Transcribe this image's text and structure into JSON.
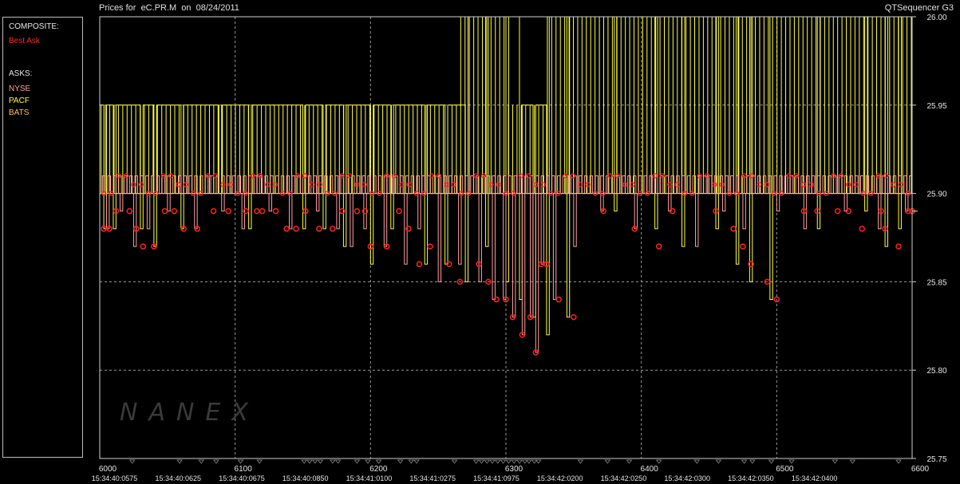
{
  "header": {
    "title": "Prices for  eC.PR.M  on  08/24/2011",
    "app": "QTSequencer G3"
  },
  "legend": {
    "composite_heading": "COMPOSITE:",
    "composite_item": "Best Ask",
    "asks_heading": "ASKS:",
    "asks_items": [
      "NYSE",
      "PACF",
      "BATS"
    ]
  },
  "colors": {
    "background": "#000000",
    "plot_border": "#cfcfcf",
    "grid": "#9a9a9a",
    "best_ask": "#ff2020",
    "nyse": "#ffa0a0",
    "pacf": "#ffff40",
    "bats": "#ffc060",
    "tick_marker": "#8a8a8a"
  },
  "watermark": "NANEX",
  "chart_data": {
    "type": "line",
    "title": "Prices for  eC.PR.M  on  08/24/2011",
    "ylim": [
      25.75,
      26.0
    ],
    "y_ticks": [
      "25.75",
      "25.80",
      "25.85",
      "25.90",
      "25.95",
      "26.00"
    ],
    "y_tick_values": [
      25.75,
      25.8,
      25.85,
      25.9,
      25.95,
      26.0
    ],
    "xlim": [
      6000,
      6600
    ],
    "x_ticks": [
      "6000",
      "6100",
      "6200",
      "6300",
      "6400",
      "6500",
      "6600"
    ],
    "x_tick_values": [
      6000,
      6100,
      6200,
      6300,
      6400,
      6500,
      6600
    ],
    "time_labels": [
      {
        "seq": 6005,
        "label": "15:34:40:0575"
      },
      {
        "seq": 6052,
        "label": "15:34:40:0625"
      },
      {
        "seq": 6099,
        "label": "15:34:40:0675"
      },
      {
        "seq": 6146,
        "label": "15:34:40:0850"
      },
      {
        "seq": 6193,
        "label": "15:34:41:0100"
      },
      {
        "seq": 6240,
        "label": "15:34:41:0275"
      },
      {
        "seq": 6287,
        "label": "15:34:41:0975"
      },
      {
        "seq": 6334,
        "label": "15:34:42:0200"
      },
      {
        "seq": 6381,
        "label": "15:34:42:0250"
      },
      {
        "seq": 6428,
        "label": "15:34:42:0300"
      },
      {
        "seq": 6475,
        "label": "15:34:42:0350"
      },
      {
        "seq": 6522,
        "label": "15:34:42:0400"
      }
    ],
    "time_markers": [
      6024,
      6059,
      6075,
      6086,
      6104,
      6118,
      6151,
      6155,
      6159,
      6163,
      6172,
      6176,
      6190,
      6198,
      6206,
      6222,
      6230,
      6234,
      6262,
      6278,
      6282,
      6286,
      6290,
      6294,
      6298,
      6302,
      6306,
      6310,
      6314,
      6317,
      6321,
      6324,
      6355,
      6375,
      6391,
      6413,
      6441,
      6457,
      6476,
      6482,
      6496,
      6511,
      6543,
      6556,
      6590
    ],
    "series": [
      {
        "name": "PACF",
        "role": "step",
        "baseline": 25.95,
        "high_baseline": 26.0,
        "high_segments": [
          [
            6265,
            6300
          ],
          [
            6330,
            6600
          ]
        ],
        "dips": [
          [
            6003,
            25.88
          ],
          [
            6010,
            25.88
          ],
          [
            6030,
            25.88
          ],
          [
            6040,
            25.87
          ],
          [
            6060,
            25.88
          ],
          [
            6088,
            25.9
          ],
          [
            6110,
            25.88
          ],
          [
            6150,
            25.88
          ],
          [
            6165,
            25.88
          ],
          [
            6180,
            25.87
          ],
          [
            6200,
            25.86
          ],
          [
            6215,
            25.88
          ],
          [
            6240,
            25.86
          ],
          [
            6255,
            25.86
          ],
          [
            6270,
            25.85
          ],
          [
            6285,
            25.87
          ],
          [
            6300,
            25.85
          ],
          [
            6310,
            25.84
          ],
          [
            6320,
            25.83
          ],
          [
            6330,
            25.82
          ],
          [
            6345,
            25.83
          ],
          [
            6380,
            25.89
          ],
          [
            6410,
            25.88
          ],
          [
            6430,
            25.87
          ],
          [
            6455,
            25.88
          ],
          [
            6470,
            25.86
          ],
          [
            6480,
            25.85
          ],
          [
            6495,
            25.84
          ],
          [
            6530,
            25.88
          ],
          [
            6565,
            25.89
          ],
          [
            6580,
            25.87
          ],
          [
            6590,
            25.88
          ]
        ]
      },
      {
        "name": "NYSE",
        "role": "step",
        "baseline": 25.9,
        "high": 25.91,
        "dips": [
          [
            6005,
            25.88
          ],
          [
            6015,
            25.89
          ],
          [
            6025,
            25.87
          ],
          [
            6035,
            25.88
          ],
          [
            6050,
            25.89
          ],
          [
            6070,
            25.88
          ],
          [
            6090,
            25.89
          ],
          [
            6105,
            25.88
          ],
          [
            6125,
            25.89
          ],
          [
            6140,
            25.88
          ],
          [
            6160,
            25.89
          ],
          [
            6175,
            25.88
          ],
          [
            6185,
            25.87
          ],
          [
            6195,
            25.88
          ],
          [
            6210,
            25.87
          ],
          [
            6225,
            25.86
          ],
          [
            6235,
            25.88
          ],
          [
            6250,
            25.85
          ],
          [
            6265,
            25.86
          ],
          [
            6280,
            25.85
          ],
          [
            6290,
            25.84
          ],
          [
            6298,
            25.84
          ],
          [
            6305,
            25.83
          ],
          [
            6312,
            25.82
          ],
          [
            6318,
            25.83
          ],
          [
            6322,
            25.81
          ],
          [
            6326,
            25.86
          ],
          [
            6335,
            25.84
          ],
          [
            6350,
            25.87
          ],
          [
            6370,
            25.89
          ],
          [
            6395,
            25.88
          ],
          [
            6420,
            25.89
          ],
          [
            6440,
            25.87
          ],
          [
            6460,
            25.89
          ],
          [
            6475,
            25.88
          ],
          [
            6500,
            25.89
          ],
          [
            6520,
            25.88
          ],
          [
            6550,
            25.89
          ],
          [
            6575,
            25.88
          ],
          [
            6595,
            25.89
          ]
        ]
      },
      {
        "name": "Best Ask",
        "role": "points",
        "points": [
          [
            6003,
            25.88
          ],
          [
            6007,
            25.88
          ],
          [
            6012,
            25.89
          ],
          [
            6022,
            25.89
          ],
          [
            6027,
            25.88
          ],
          [
            6032,
            25.87
          ],
          [
            6040,
            25.87
          ],
          [
            6048,
            25.89
          ],
          [
            6055,
            25.89
          ],
          [
            6062,
            25.88
          ],
          [
            6072,
            25.88
          ],
          [
            6084,
            25.89
          ],
          [
            6095,
            25.89
          ],
          [
            6108,
            25.89
          ],
          [
            6116,
            25.89
          ],
          [
            6120,
            25.89
          ],
          [
            6130,
            25.89
          ],
          [
            6138,
            25.88
          ],
          [
            6145,
            25.88
          ],
          [
            6152,
            25.89
          ],
          [
            6162,
            25.88
          ],
          [
            6172,
            25.88
          ],
          [
            6179,
            25.89
          ],
          [
            6190,
            25.89
          ],
          [
            6196,
            25.89
          ],
          [
            6200,
            25.87
          ],
          [
            6212,
            25.87
          ],
          [
            6221,
            25.89
          ],
          [
            6228,
            25.88
          ],
          [
            6236,
            25.86
          ],
          [
            6244,
            25.87
          ],
          [
            6258,
            25.86
          ],
          [
            6266,
            25.85
          ],
          [
            6280,
            25.86
          ],
          [
            6287,
            25.85
          ],
          [
            6293,
            25.84
          ],
          [
            6300,
            25.84
          ],
          [
            6305,
            25.83
          ],
          [
            6312,
            25.82
          ],
          [
            6318,
            25.83
          ],
          [
            6322,
            25.81
          ],
          [
            6326,
            25.86
          ],
          [
            6330,
            25.86
          ],
          [
            6339,
            25.84
          ],
          [
            6350,
            25.83
          ],
          [
            6372,
            25.89
          ],
          [
            6395,
            25.88
          ],
          [
            6413,
            25.87
          ],
          [
            6423,
            25.89
          ],
          [
            6455,
            25.89
          ],
          [
            6468,
            25.88
          ],
          [
            6475,
            25.87
          ],
          [
            6481,
            25.86
          ],
          [
            6493,
            25.85
          ],
          [
            6500,
            25.84
          ],
          [
            6520,
            25.89
          ],
          [
            6530,
            25.89
          ],
          [
            6545,
            25.89
          ],
          [
            6553,
            25.89
          ],
          [
            6563,
            25.88
          ],
          [
            6577,
            25.89
          ],
          [
            6580,
            25.88
          ],
          [
            6590,
            25.87
          ],
          [
            6597,
            25.89
          ],
          [
            6600,
            25.89
          ]
        ]
      },
      {
        "name": "BATS",
        "role": "step",
        "baseline": 25.9
      }
    ]
  }
}
